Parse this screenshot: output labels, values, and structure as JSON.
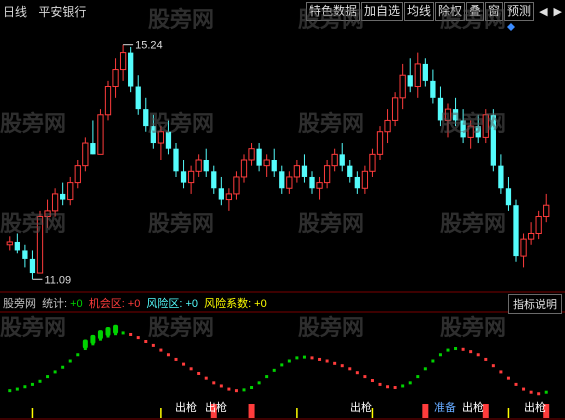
{
  "toolbar": {
    "period": "日线",
    "stock_name": "平安银行",
    "buttons": [
      "特色数据",
      "加自选",
      "均线",
      "除权",
      "叠",
      "窗",
      "预测"
    ],
    "arrow_left": "◀",
    "arrow_right": "▶"
  },
  "price_labels": {
    "high": "15.24",
    "low": "11.09"
  },
  "indicator": {
    "name": "股旁网",
    "stat_label": "统计:",
    "stat_value": "+0",
    "opp_label": "机会区:",
    "opp_value": "+0",
    "risk_label": "风险区:",
    "risk_value": "+0",
    "coef_label": "风险系数:",
    "coef_value": "+0",
    "help_button": "指标说明"
  },
  "signals": [
    "出枪",
    "出枪",
    "出枪",
    "准备",
    "出枪",
    "出枪"
  ],
  "watermark": "股旁网",
  "colors": {
    "up": "#ff3c3c",
    "down": "#54fcfc",
    "green": "#00d200",
    "yellow": "#ffff00",
    "magenta": "#ff50ff",
    "orange": "#ffa000",
    "grid": "#7a0000"
  },
  "chart_data": {
    "type": "candlestick",
    "ohlc": [
      [
        11.7,
        11.85,
        11.6,
        11.75
      ],
      [
        11.75,
        11.9,
        11.55,
        11.6
      ],
      [
        11.6,
        11.7,
        11.3,
        11.45
      ],
      [
        11.45,
        11.6,
        11.09,
        11.2
      ],
      [
        11.2,
        12.3,
        11.2,
        12.2
      ],
      [
        12.2,
        12.5,
        12.0,
        12.3
      ],
      [
        12.3,
        12.7,
        12.2,
        12.6
      ],
      [
        12.6,
        12.8,
        12.4,
        12.5
      ],
      [
        12.5,
        12.9,
        12.4,
        12.8
      ],
      [
        12.8,
        13.2,
        12.7,
        13.1
      ],
      [
        13.1,
        13.6,
        13.0,
        13.5
      ],
      [
        13.5,
        13.9,
        13.3,
        13.3
      ],
      [
        13.3,
        14.1,
        13.3,
        14.0
      ],
      [
        14.0,
        14.6,
        13.9,
        14.5
      ],
      [
        14.5,
        15.0,
        14.3,
        14.8
      ],
      [
        14.8,
        15.24,
        14.6,
        15.1
      ],
      [
        15.1,
        15.2,
        14.4,
        14.5
      ],
      [
        14.5,
        14.7,
        14.0,
        14.1
      ],
      [
        14.1,
        14.3,
        13.7,
        13.8
      ],
      [
        13.8,
        14.0,
        13.4,
        13.5
      ],
      [
        13.5,
        13.8,
        13.2,
        13.7
      ],
      [
        13.7,
        13.9,
        13.3,
        13.4
      ],
      [
        13.4,
        13.5,
        12.9,
        13.0
      ],
      [
        13.0,
        13.2,
        12.7,
        12.8
      ],
      [
        12.8,
        13.1,
        12.6,
        13.0
      ],
      [
        13.0,
        13.3,
        12.9,
        13.2
      ],
      [
        13.2,
        13.4,
        12.9,
        13.0
      ],
      [
        13.0,
        13.1,
        12.6,
        12.7
      ],
      [
        12.7,
        12.9,
        12.4,
        12.5
      ],
      [
        12.5,
        12.7,
        12.3,
        12.6
      ],
      [
        12.6,
        13.0,
        12.5,
        12.9
      ],
      [
        12.9,
        13.3,
        12.8,
        13.2
      ],
      [
        13.2,
        13.5,
        13.1,
        13.4
      ],
      [
        13.4,
        13.5,
        13.0,
        13.1
      ],
      [
        13.1,
        13.3,
        12.9,
        13.2
      ],
      [
        13.2,
        13.4,
        12.9,
        13.0
      ],
      [
        13.0,
        13.1,
        12.6,
        12.7
      ],
      [
        12.7,
        13.0,
        12.6,
        12.9
      ],
      [
        12.9,
        13.2,
        12.8,
        13.1
      ],
      [
        13.1,
        13.3,
        12.8,
        12.9
      ],
      [
        12.9,
        13.0,
        12.6,
        12.7
      ],
      [
        12.7,
        12.9,
        12.5,
        12.8
      ],
      [
        12.8,
        13.2,
        12.7,
        13.1
      ],
      [
        13.1,
        13.4,
        13.0,
        13.3
      ],
      [
        13.3,
        13.5,
        13.0,
        13.1
      ],
      [
        13.1,
        13.2,
        12.8,
        12.9
      ],
      [
        12.9,
        13.0,
        12.6,
        12.7
      ],
      [
        12.7,
        13.1,
        12.6,
        13.0
      ],
      [
        13.0,
        13.4,
        12.9,
        13.3
      ],
      [
        13.3,
        13.8,
        13.2,
        13.7
      ],
      [
        13.7,
        14.1,
        13.5,
        13.9
      ],
      [
        13.9,
        14.4,
        13.8,
        14.3
      ],
      [
        14.3,
        14.9,
        14.1,
        14.7
      ],
      [
        14.7,
        15.0,
        14.4,
        14.5
      ],
      [
        14.5,
        15.1,
        14.3,
        14.9
      ],
      [
        14.9,
        15.0,
        14.5,
        14.6
      ],
      [
        14.6,
        14.8,
        14.2,
        14.3
      ],
      [
        14.3,
        14.5,
        13.8,
        13.9
      ],
      [
        13.9,
        14.2,
        13.6,
        14.1
      ],
      [
        14.1,
        14.3,
        13.8,
        13.9
      ],
      [
        13.9,
        14.1,
        13.5,
        13.6
      ],
      [
        13.6,
        13.9,
        13.4,
        13.8
      ],
      [
        13.8,
        14.0,
        13.5,
        13.6
      ],
      [
        13.6,
        14.1,
        13.5,
        14.0
      ],
      [
        14.0,
        14.1,
        13.0,
        13.1
      ],
      [
        13.1,
        13.3,
        12.6,
        12.7
      ],
      [
        12.7,
        12.9,
        12.3,
        12.4
      ],
      [
        12.4,
        12.5,
        11.4,
        11.5
      ],
      [
        11.5,
        11.9,
        11.3,
        11.8
      ],
      [
        11.8,
        12.1,
        11.7,
        11.9
      ],
      [
        11.9,
        12.3,
        11.8,
        12.2
      ],
      [
        12.2,
        12.6,
        12.1,
        12.4
      ]
    ],
    "price_range": [
      10.9,
      15.5
    ],
    "indicator_line": [
      0.12,
      0.14,
      0.17,
      0.2,
      0.24,
      0.3,
      0.36,
      0.42,
      0.5,
      0.58,
      0.66,
      0.72,
      0.78,
      0.82,
      0.85,
      0.86,
      0.84,
      0.8,
      0.75,
      0.7,
      0.64,
      0.58,
      0.52,
      0.46,
      0.4,
      0.34,
      0.28,
      0.22,
      0.18,
      0.14,
      0.12,
      0.13,
      0.16,
      0.22,
      0.3,
      0.38,
      0.45,
      0.5,
      0.54,
      0.55,
      0.54,
      0.52,
      0.5,
      0.47,
      0.44,
      0.4,
      0.35,
      0.3,
      0.25,
      0.2,
      0.17,
      0.16,
      0.18,
      0.22,
      0.3,
      0.4,
      0.5,
      0.58,
      0.64,
      0.66,
      0.65,
      0.62,
      0.58,
      0.52,
      0.44,
      0.36,
      0.28,
      0.2,
      0.14,
      0.1,
      0.08,
      0.1
    ],
    "signal_bars": [
      27,
      32,
      55,
      63,
      71
    ],
    "yellow_ticks": [
      3,
      20,
      38,
      48,
      66
    ],
    "opportunity_dots": [
      10,
      11,
      12,
      13,
      14
    ]
  }
}
